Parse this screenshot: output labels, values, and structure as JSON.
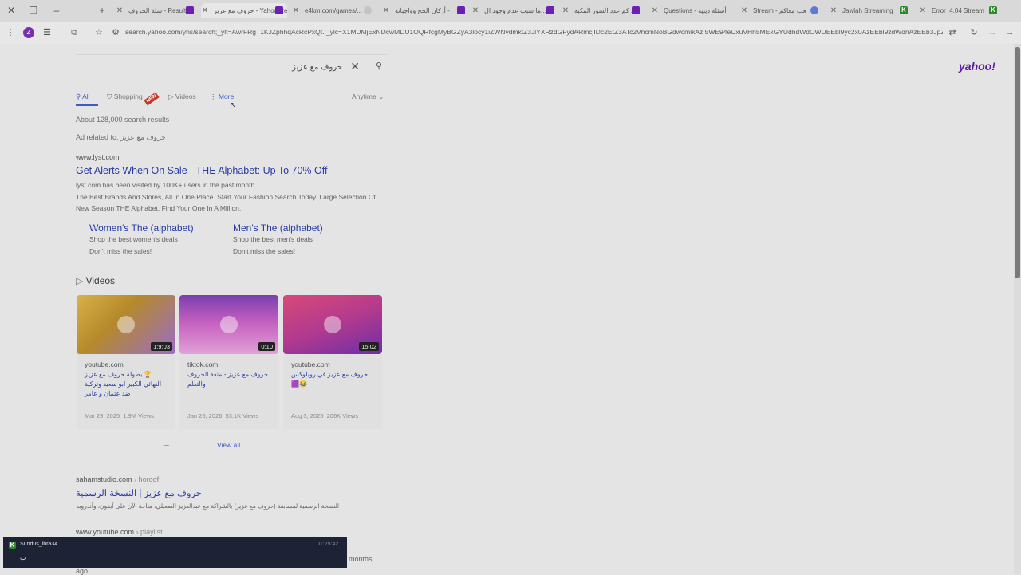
{
  "tabs": [
    {
      "label": "سلة الحروف - Results",
      "favicon": "purple"
    },
    {
      "label": "حروف مع عزيز - Yahoo Results",
      "favicon": "purple",
      "active": true
    },
    {
      "label": "e4km.com/games/...",
      "favicon": "gray"
    },
    {
      "label": "أركان الحج وواجباته -",
      "favicon": "purple"
    },
    {
      "label": "ما سبب عدم وجود ال...",
      "favicon": "purple"
    },
    {
      "label": "كم عدد السور المكية ...",
      "favicon": "purple"
    },
    {
      "label": "Questions - أسئلة دينية",
      "favicon": "blue"
    },
    {
      "label": "Stream - تلعب معاكم",
      "favicon": "k"
    },
    {
      "label": "Jawlah Streaming",
      "favicon": "k"
    },
    {
      "label": "Error_4.04 Stream",
      "favicon": "k"
    }
  ],
  "address": {
    "url": "search.yahoo.com/yhs/search;_ylt=AwrFRgT1KJZphhqAcRcPxQt.;_ylc=X1MDMjExNDcwMDU1OQRfcgMyBGZyA3locy1iZWNvdmktZ3JlYXRzdGFydARmcjIDc2EtZ3ATc2VhcmNoBGdwcmlkAzI5WE94eUxuVHh5MExGYUdhdWdOWUEEbl9yc2x0AzEEbl9zdWdnAzEEb3JpZ2lu",
    "profile_initial": "Z"
  },
  "search": {
    "query": "حروف مع عزيز",
    "logo": "yahoo!",
    "filters": {
      "all": "All",
      "shopping": "Shopping",
      "new_badge": "NEW",
      "videos": "Videos",
      "more": "More",
      "time": "Anytime"
    },
    "result_count": "About 128,000 search results",
    "ad_related_label": "Ad related to:",
    "ad_related_query": "حروف مع عزيز"
  },
  "ad": {
    "domain": "www.lyst.com",
    "title": "Get Alerts When On Sale - THE Alphabet: Up To 70% Off",
    "line1": "lyst.com has been visited by 100K+ users in the past month",
    "line2": "The Best Brands And Stores, All In One Place. Start Your Fashion Search Today. Large Selection Of",
    "line3": "New Season THE Alphabet. Find Your One In A Million.",
    "sitelinks": [
      {
        "title": "Women's The (alphabet)",
        "desc1": "Shop the best women's deals",
        "desc2": "Don't miss the sales!"
      },
      {
        "title": "Men's The (alphabet)",
        "desc1": "Shop the best men's deals",
        "desc2": "Don't miss the sales!"
      }
    ]
  },
  "videos": {
    "heading": "Videos",
    "view_all": "View all",
    "items": [
      {
        "source": "youtube.com",
        "title": "🏆 بطولة حروف مع عزيز النهائي الكبير ابو سعيد وتركية ضد عثمان و عامر",
        "date": "Mar 29, 2025",
        "views": "1.9M Views",
        "duration": "1:9:03",
        "thumb_color": "#c9a040"
      },
      {
        "source": "tiktok.com",
        "title": "حروف مع عزيز - متعة الحروف والتعلم",
        "date": "Jan 26, 2026",
        "views": "53.1K Views",
        "duration": "0:10",
        "thumb_color": "#a04aa8"
      },
      {
        "source": "youtube.com",
        "title": "حروف مع عزيز في روبلوكس 😂🟪",
        "date": "Aug 3, 2025",
        "views": "206K Views",
        "duration": "15:02",
        "thumb_color": "#c83a6e"
      }
    ]
  },
  "results": [
    {
      "domain": "sahamstudio.com",
      "path": "› horoof",
      "title": "حروف مع عزيز | النسخة الرسمية",
      "desc": "النسخة الرسمية لمسابقة (حروف مع عزيز) بالشراكة مع عبدالعزيز الصعيلي، متاحة الآن على آيفون، وأندرويد وويندوز"
    },
    {
      "domain": "www.youtube.com",
      "path": "› playlist",
      "trailing": "months",
      "trailing2": "ago"
    }
  ],
  "chat": {
    "username": "Sundus_ibra34",
    "time": "01:25:42",
    "message": "ب"
  }
}
